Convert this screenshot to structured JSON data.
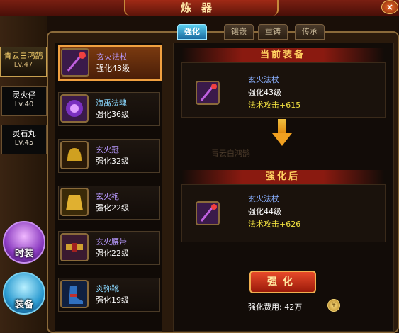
{
  "window": {
    "title": "炼器",
    "close_label": "×"
  },
  "tabs": [
    {
      "label": "强化",
      "active": true
    },
    {
      "label": "镶嵌",
      "active": false
    },
    {
      "label": "重铸",
      "active": false
    },
    {
      "label": "传承",
      "active": false
    }
  ],
  "characters": [
    {
      "name": "青云白鸿鹄",
      "level": "Lv.47",
      "selected": true
    },
    {
      "name": "灵火仔",
      "level": "Lv.40",
      "selected": false
    },
    {
      "name": "灵石丸",
      "level": "Lv.45",
      "selected": false
    }
  ],
  "side_buttons": {
    "fashion": "时装",
    "equipment": "装备"
  },
  "items": [
    {
      "name": "玄火法杖",
      "level": "强化43级",
      "icon": "staff-icon",
      "selected": true
    },
    {
      "name": "海禹法魂",
      "level": "强化36级",
      "icon": "swirl-soul-icon",
      "selected": false
    },
    {
      "name": "玄火冠",
      "level": "强化32级",
      "icon": "helmet-icon",
      "selected": false
    },
    {
      "name": "玄火袍",
      "level": "强化22级",
      "icon": "robe-icon",
      "selected": false
    },
    {
      "name": "玄火腰带",
      "level": "强化22级",
      "icon": "belt-icon",
      "selected": false
    },
    {
      "name": "炎弥靴",
      "level": "强化19级",
      "icon": "boots-icon",
      "selected": false
    }
  ],
  "current": {
    "header": "当前装备",
    "name": "玄火法杖",
    "level": "强化43级",
    "attack": "法术攻击+615"
  },
  "after": {
    "header": "强化后",
    "name": "玄火法杖",
    "level": "强化44级",
    "attack": "法术攻击+626"
  },
  "watermark": "青云白鸿鹄",
  "enhance_button": "强化",
  "cost": "强化费用: 42万"
}
